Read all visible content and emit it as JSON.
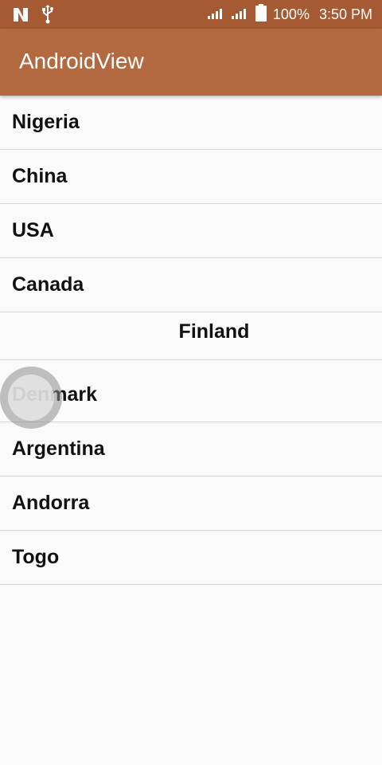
{
  "status_bar": {
    "battery_percent": "100%",
    "time": "3:50 PM",
    "icons": [
      "notification-n-icon",
      "usb-icon",
      "signal-icon",
      "signal-icon",
      "battery-icon"
    ]
  },
  "app_bar": {
    "title": "AndroidView"
  },
  "countries": [
    "Nigeria",
    "China",
    "USA",
    "Canada",
    "Finland",
    "Denmark",
    "Argentina",
    "Andorra",
    "Togo"
  ]
}
